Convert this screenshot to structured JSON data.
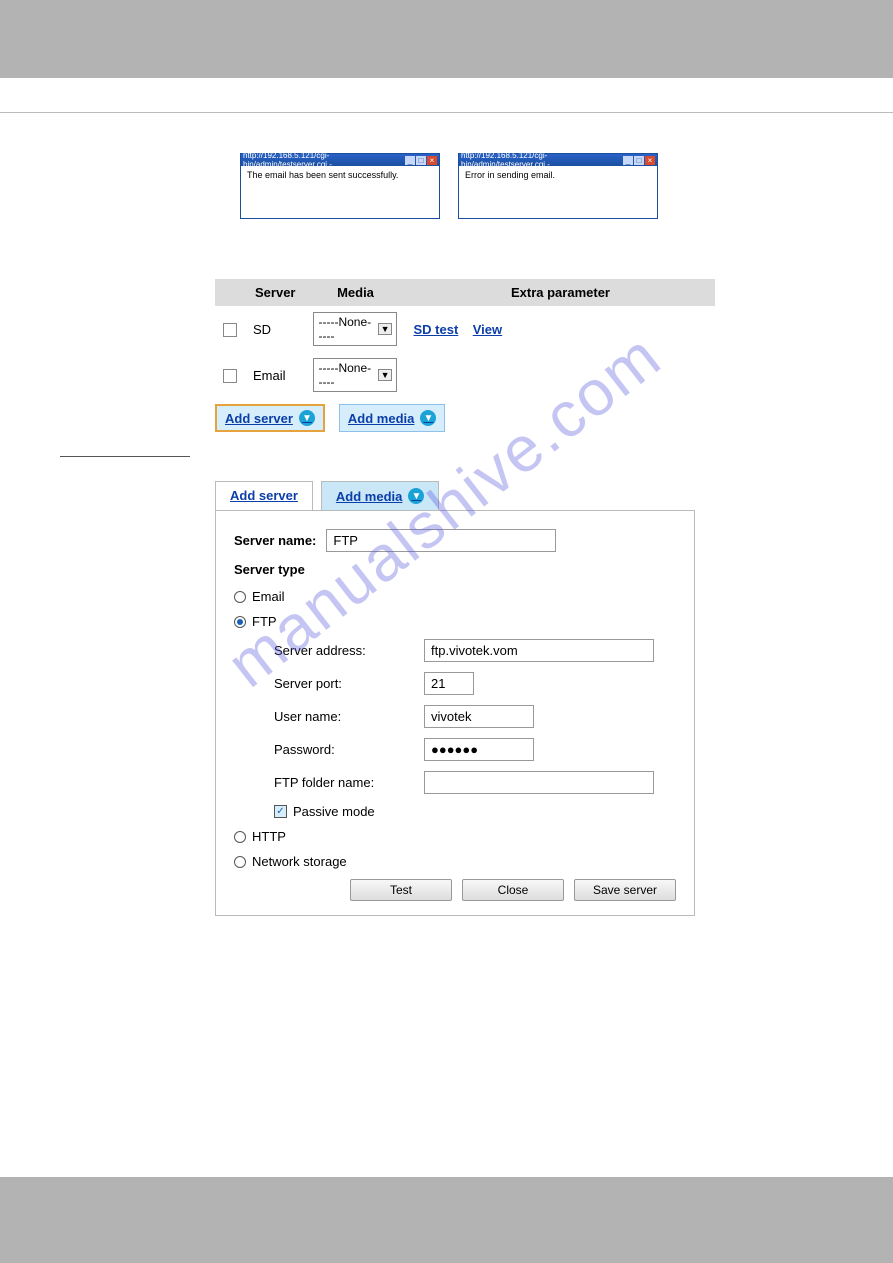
{
  "popups": {
    "left_title": "http://192.168.5.121/cgi-bin/admin/testserver.cgi -",
    "right_title": "http://192.168.5.121/cgi-bin/admin/testserver.cgi -",
    "left_msg": "The email has been sent successfully.",
    "right_msg": "Error in sending email."
  },
  "table": {
    "headers": {
      "server": "Server",
      "media": "Media",
      "extra": "Extra parameter"
    },
    "row1": {
      "name": "SD",
      "media": "-----None-----",
      "link_test": "SD test",
      "link_view": "View"
    },
    "row2": {
      "name": "Email",
      "media": "-----None-----"
    },
    "add_server": "Add server",
    "add_media": "Add media"
  },
  "tabs": {
    "add_server": "Add server",
    "add_media": "Add media"
  },
  "form": {
    "server_name_label": "Server name:",
    "server_name_value": "FTP",
    "server_type_label": "Server type",
    "opt_email": "Email",
    "opt_ftp": "FTP",
    "opt_http": "HTTP",
    "opt_ns": "Network storage",
    "ftp": {
      "addr_label": "Server address:",
      "addr_value": "ftp.vivotek.vom",
      "port_label": "Server port:",
      "port_value": "21",
      "user_label": "User name:",
      "user_value": "vivotek",
      "pass_label": "Password:",
      "pass_value": "●●●●●●",
      "folder_label": "FTP folder name:",
      "folder_value": "",
      "passive_label": "Passive mode"
    },
    "buttons": {
      "test": "Test",
      "close": "Close",
      "save": "Save server"
    }
  },
  "watermark": "manualshive.com"
}
